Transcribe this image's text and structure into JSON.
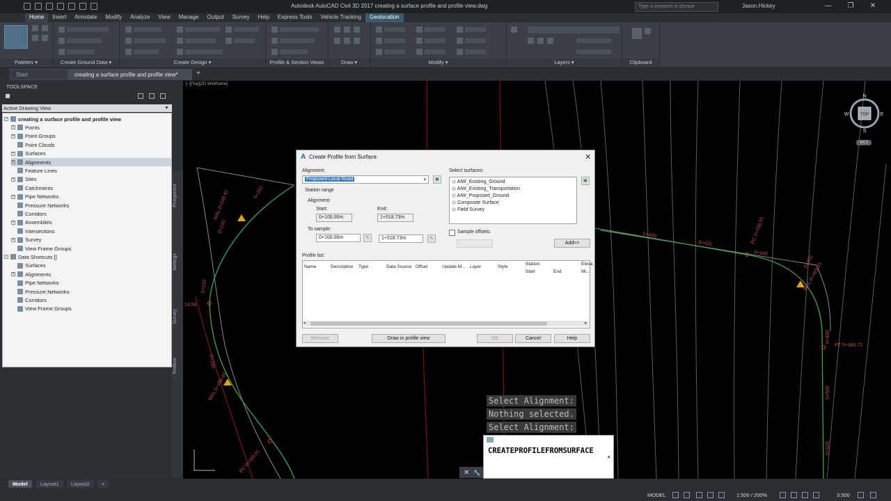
{
  "title_bar": {
    "app_title": "Autodesk AutoCAD Civil 3D 2017   creating a surface profile and profile view.dwg",
    "search_placeholder": "Type a keyword or phrase",
    "user": "Jason.Hickey",
    "minimize": "—",
    "maximize": "❐",
    "close": "✕"
  },
  "ribbon": {
    "tabs": [
      "Home",
      "Insert",
      "Annotate",
      "Modify",
      "Analyze",
      "View",
      "Manage",
      "Output",
      "Survey",
      "Help",
      "Express Tools",
      "Vehicle Tracking",
      "Geolocation"
    ],
    "active_tab": "Home",
    "panels": [
      "Palettes ▾",
      "Create Ground Data ▾",
      "Create Design ▾",
      "Profile & Section Views",
      "Draw ▾",
      "Modify ▾",
      "Layers ▾",
      "Clipboard"
    ]
  },
  "doc_tabs": {
    "start": "Start",
    "current": "creating a surface profile and profile view*",
    "close_icon": "✕",
    "plus": "+"
  },
  "toolspace": {
    "header": "TOOLSPACE",
    "dropdown": "Active Drawing View",
    "side_tabs": [
      "Prospector",
      "Settings",
      "Survey",
      "Toolbox"
    ],
    "tree": [
      {
        "label": "creating a surface profile and profile view",
        "level": 0,
        "bold": true,
        "expander": "−"
      },
      {
        "label": "Points",
        "level": 1,
        "expander": "+"
      },
      {
        "label": "Point Groups",
        "level": 1,
        "expander": "+"
      },
      {
        "label": "Point Clouds",
        "level": 1,
        "expander": ""
      },
      {
        "label": "Surfaces",
        "level": 1,
        "expander": "+"
      },
      {
        "label": "Alignments",
        "level": 1,
        "expander": "+",
        "selected": true
      },
      {
        "label": "Feature Lines",
        "level": 1,
        "expander": ""
      },
      {
        "label": "Sites",
        "level": 1,
        "expander": "+"
      },
      {
        "label": "Catchments",
        "level": 1,
        "expander": ""
      },
      {
        "label": "Pipe Networks",
        "level": 1,
        "expander": "+"
      },
      {
        "label": "Pressure Networks",
        "level": 1,
        "expander": ""
      },
      {
        "label": "Corridors",
        "level": 1,
        "expander": ""
      },
      {
        "label": "Assemblies",
        "level": 1,
        "expander": "+"
      },
      {
        "label": "Intersections",
        "level": 1,
        "expander": ""
      },
      {
        "label": "Survey",
        "level": 1,
        "expander": "+"
      },
      {
        "label": "View Frame Groups",
        "level": 1,
        "expander": ""
      },
      {
        "label": "Data Shortcuts []",
        "level": 0,
        "expander": "−"
      },
      {
        "label": "Surfaces",
        "level": 1,
        "expander": ""
      },
      {
        "label": "Alignments",
        "level": 1,
        "expander": "+"
      },
      {
        "label": "Pipe Networks",
        "level": 1,
        "expander": ""
      },
      {
        "label": "Pressure Networks",
        "level": 1,
        "expander": ""
      },
      {
        "label": "Corridors",
        "level": 1,
        "expander": ""
      },
      {
        "label": "View Frame Groups",
        "level": 1,
        "expander": ""
      }
    ]
  },
  "viewport": {
    "label": "[−][Top][2D Wireframe]",
    "compass": {
      "n": "N",
      "s": "S",
      "e": "E",
      "w": "W",
      "top": "TOP",
      "wcs": "WCS"
    },
    "drawing_labels": [
      "0+260",
      "0+240",
      "0+220",
      "0+200",
      "MAL 0+249.42",
      "PC 0+188.01",
      "MAL 0+186.65",
      "0+400",
      "0+420",
      "0+440",
      "PC 0+438.55",
      "MAL 0+469.35",
      "0+460",
      "PT 0+480.71",
      "0+480",
      "0+500",
      "0+520",
      "14.98"
    ]
  },
  "dialog": {
    "title": "Create Profile from Surface",
    "alignment_label": "Alignment:",
    "alignment_value": "Proposed Local Road",
    "station_range_label": "Station range",
    "alignment_sub_label": "Alignment:",
    "start_label": "Start:",
    "end_label": "End:",
    "start_value": "0+100.00m",
    "end_value": "1+518.73m",
    "to_sample_label": "To sample:",
    "sample_start": "0+100.00m",
    "sample_end": "1+518.73m",
    "select_surfaces_label": "Select surfaces:",
    "surfaces": [
      "AIW_Existing_Ground",
      "AIW_Existing_Transportation",
      "AIW_Proposed_Ground",
      "Composite Surface",
      "Field Survey"
    ],
    "sample_offsets_label": "Sample offsets:",
    "add_button": "Add>>",
    "profile_list_label": "Profile list:",
    "columns": [
      "Name",
      "Description",
      "Type",
      "Data Source",
      "Offset",
      "Update M...",
      "Layer",
      "Style",
      "Station",
      "Start",
      "End",
      "Eleva",
      "Mi..."
    ],
    "buttons": {
      "remove": "Remove",
      "draw": "Draw in profile view",
      "ok": "OK",
      "cancel": "Cancel",
      "help": "Help"
    },
    "close": "✕"
  },
  "command": {
    "history": [
      "Select Alignment:",
      "Nothing selected.",
      "Select Alignment:"
    ],
    "current": "CREATEPROFILEFROMSURFACE",
    "ctrl_close": "✕",
    "ctrl_wrench": "🔧"
  },
  "status_bar": {
    "layout_tabs": [
      "Model",
      "Layout1",
      "Layout2"
    ],
    "plus": "+",
    "model": "MODEL",
    "scale": "1:500 / 200%",
    "value": "3.500"
  },
  "colors": {
    "dialog_bg": "#f0f0f0",
    "alignment_green": "#3fa64a",
    "boundary_red": "#8a1a24",
    "contour_gray": "#6a6a6a"
  }
}
